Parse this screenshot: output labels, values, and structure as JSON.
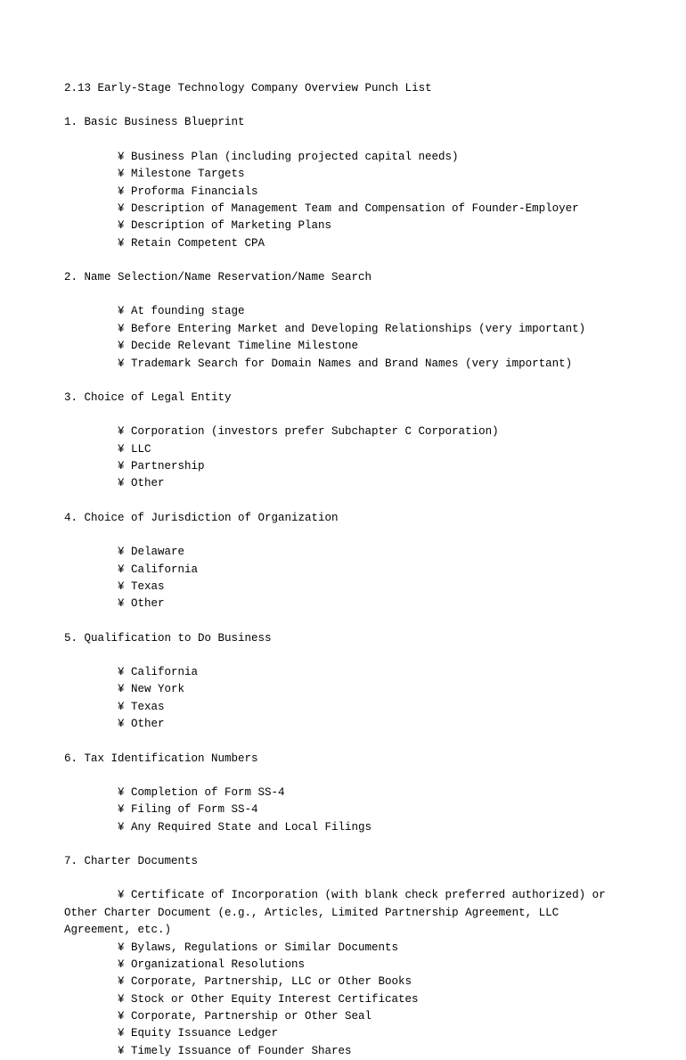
{
  "title": "2.13  Early-Stage Technology Company Overview Punch List",
  "sections": [
    {
      "heading": "1. Basic Business Blueprint",
      "items": [
        "¥ Business Plan (including projected capital needs)",
        "¥ Milestone Targets",
        "¥ Proforma Financials",
        "¥ Description of Management Team and Compensation of Founder-Employer",
        "¥ Description of Marketing Plans",
        "¥ Retain Competent CPA"
      ]
    },
    {
      "heading": "2. Name Selection/Name Reservation/Name Search",
      "items": [
        "¥ At founding stage",
        "¥ Before Entering Market and Developing Relationships (very important)",
        "¥ Decide Relevant Timeline Milestone",
        "¥ Trademark Search for Domain Names and Brand Names (very important)"
      ]
    },
    {
      "heading": "3. Choice of Legal Entity",
      "items": [
        "¥ Corporation (investors prefer Subchapter C Corporation)",
        "¥ LLC",
        "¥ Partnership",
        "¥ Other"
      ]
    },
    {
      "heading": "4. Choice of Jurisdiction of Organization",
      "items": [
        "¥ Delaware",
        "¥ California",
        "¥ Texas",
        "¥ Other"
      ]
    },
    {
      "heading": "5. Qualification to Do Business",
      "items": [
        "¥ California",
        "¥ New York",
        "¥ Texas",
        "¥ Other"
      ]
    },
    {
      "heading": "6. Tax Identification Numbers",
      "items": [
        "¥ Completion of Form SS-4",
        "¥ Filing of Form SS-4",
        "¥ Any Required State and Local Filings"
      ]
    },
    {
      "heading": "7. Charter Documents",
      "wrappedFirstItem": {
        "line1": "¥ Certificate of Incorporation (with blank check preferred authorized) or",
        "line2": "Other Charter Document (e.g., Articles, Limited Partnership Agreement, LLC",
        "line3": "Agreement, etc.)"
      },
      "items": [
        "¥ Bylaws, Regulations or Similar Documents",
        "¥ Organizational Resolutions",
        "¥ Corporate, Partnership, LLC or Other Books",
        "¥ Stock or Other Equity Interest Certificates",
        "¥ Corporate, Partnership or Other Seal",
        "¥ Equity Issuance Ledger",
        "¥ Timely Issuance of Founder Shares"
      ]
    }
  ]
}
